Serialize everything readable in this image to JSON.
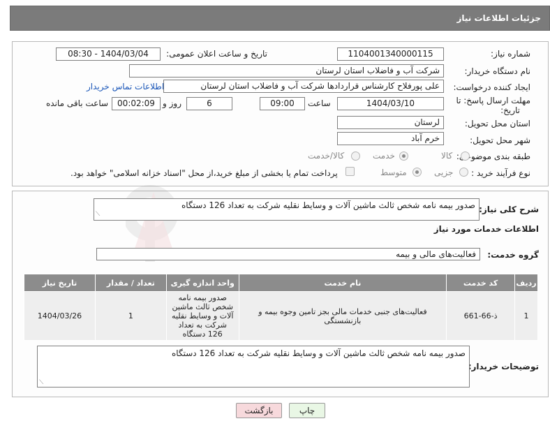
{
  "header": {
    "title": "جزئیات اطلاعات نیاز"
  },
  "form": {
    "need_number_label": "شماره نیاز:",
    "need_number": "1104001340000115",
    "announce_label": "تاریخ و ساعت اعلان عمومی:",
    "announce_value": "1404/03/04 - 08:30",
    "buyer_org_label": "نام دستگاه خریدار:",
    "buyer_org": "شرکت آب و فاضلاب استان لرستان",
    "requester_label": "ایجاد کننده درخواست:",
    "requester": "علی پورفلاح کارشناس قراردادها شرکت آب و فاضلاب استان لرستان",
    "contact_link": "اطلاعات تماس خریدار",
    "deadline_label_1": "مهلت ارسال پاسخ: تا",
    "deadline_label_2": "تاریخ:",
    "deadline_date": "1404/03/10",
    "time_label": "ساعت",
    "deadline_time": "09:00",
    "days_value": "6",
    "days_label": "روز و",
    "remaining_value": "00:02:09",
    "remaining_label": "ساعت باقی مانده",
    "province_label": "استان محل تحویل:",
    "province": "لرستان",
    "city_label": "شهر محل تحویل:",
    "city": "خرم آباد",
    "category_label": "طبقه بندی موضوعی:",
    "category_options": [
      "کالا",
      "خدمت",
      "کالا/خدمت"
    ],
    "category_selected": "خدمت",
    "purchase_type_label": "نوع فرآیند خرید :",
    "purchase_options": [
      "جزیی",
      "متوسط"
    ],
    "purchase_selected": "متوسط",
    "payment_note": "پرداخت تمام یا بخشی از مبلغ خرید،از محل \"اسناد خزانه اسلامی\" خواهد بود."
  },
  "summary": {
    "label": "شرح کلی نیاز:",
    "text": "صدور بیمه نامه شخص ثالث ماشین آلات و وسایط نقلیه شرکت به تعداد 126 دستگاه"
  },
  "services": {
    "section_title": "اطلاعات خدمات مورد نیاز",
    "group_label": "گروه خدمت:",
    "group_value": "فعالیت‌های مالی و بیمه",
    "columns": [
      "ردیف",
      "کد خدمت",
      "نام خدمت",
      "واحد اندازه گیری",
      "تعداد / مقدار",
      "تاریخ نیاز"
    ],
    "rows": [
      {
        "row": "1",
        "code": "ذ-66-661",
        "name": "فعالیت‌های جنبی خدمات مالی بجز تامین وجوه بیمه و بازنشستگی",
        "unit": "صدور بیمه نامه شخص ثالث ماشین آلات و وسایط نقلیه شرکت به تعداد 126 دستگاه",
        "qty": "1",
        "date": "1404/03/26"
      }
    ]
  },
  "buyer_notes": {
    "label": "توضیحات خریدار:",
    "text": "صدور بیمه نامه شخص ثالث ماشین آلات و وسایط نقلیه شرکت به تعداد 126 دستگاه"
  },
  "buttons": {
    "print": "چاپ",
    "back": "بازگشت"
  },
  "colors": {
    "header_bg": "#7b7b7b",
    "table_header_bg": "#8c8c8c",
    "back_button_bg": "#f7d9dc",
    "print_button_bg": "#e9f7e5",
    "link": "#1a56b8"
  }
}
